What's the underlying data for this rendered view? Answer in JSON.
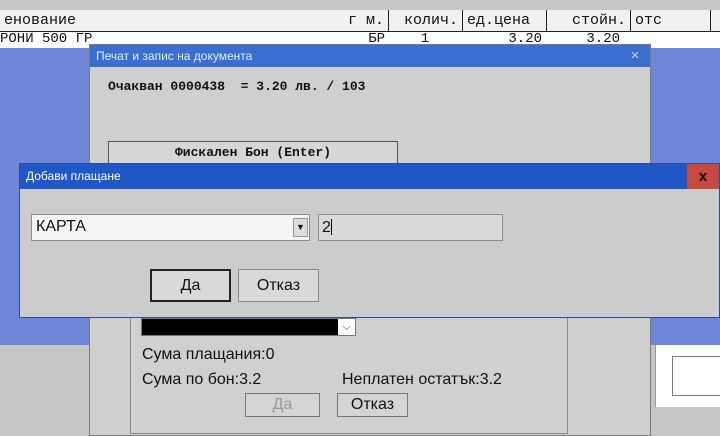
{
  "grid": {
    "columns": [
      "енование",
      "г м.",
      "колич.",
      "ед.цена",
      "стойн.",
      "отс"
    ],
    "row": [
      "РОНИ 500 ГР",
      "БР",
      "1",
      "3.20",
      "3.20"
    ]
  },
  "print_dialog": {
    "title": "Печат и запис на документа",
    "close_icon": "×",
    "expected_line": "Очакван 0000438  = 3.20 лв. / 103",
    "fiscal_button": "Фискален Бон (Enter)",
    "pay_sum_label": "Сума плащания:0",
    "bon_sum_label": "Сума по бон:3.2",
    "unpaid_label": "Неплатен остатък:3.2",
    "ok_label": "Да",
    "cancel_label": "Отказ"
  },
  "add_payment_dialog": {
    "title": "Добави плащане",
    "close_icon": "x",
    "payment_type": "КАРТА",
    "amount": "2",
    "ok_label": "Да",
    "cancel_label": "Отказ"
  }
}
